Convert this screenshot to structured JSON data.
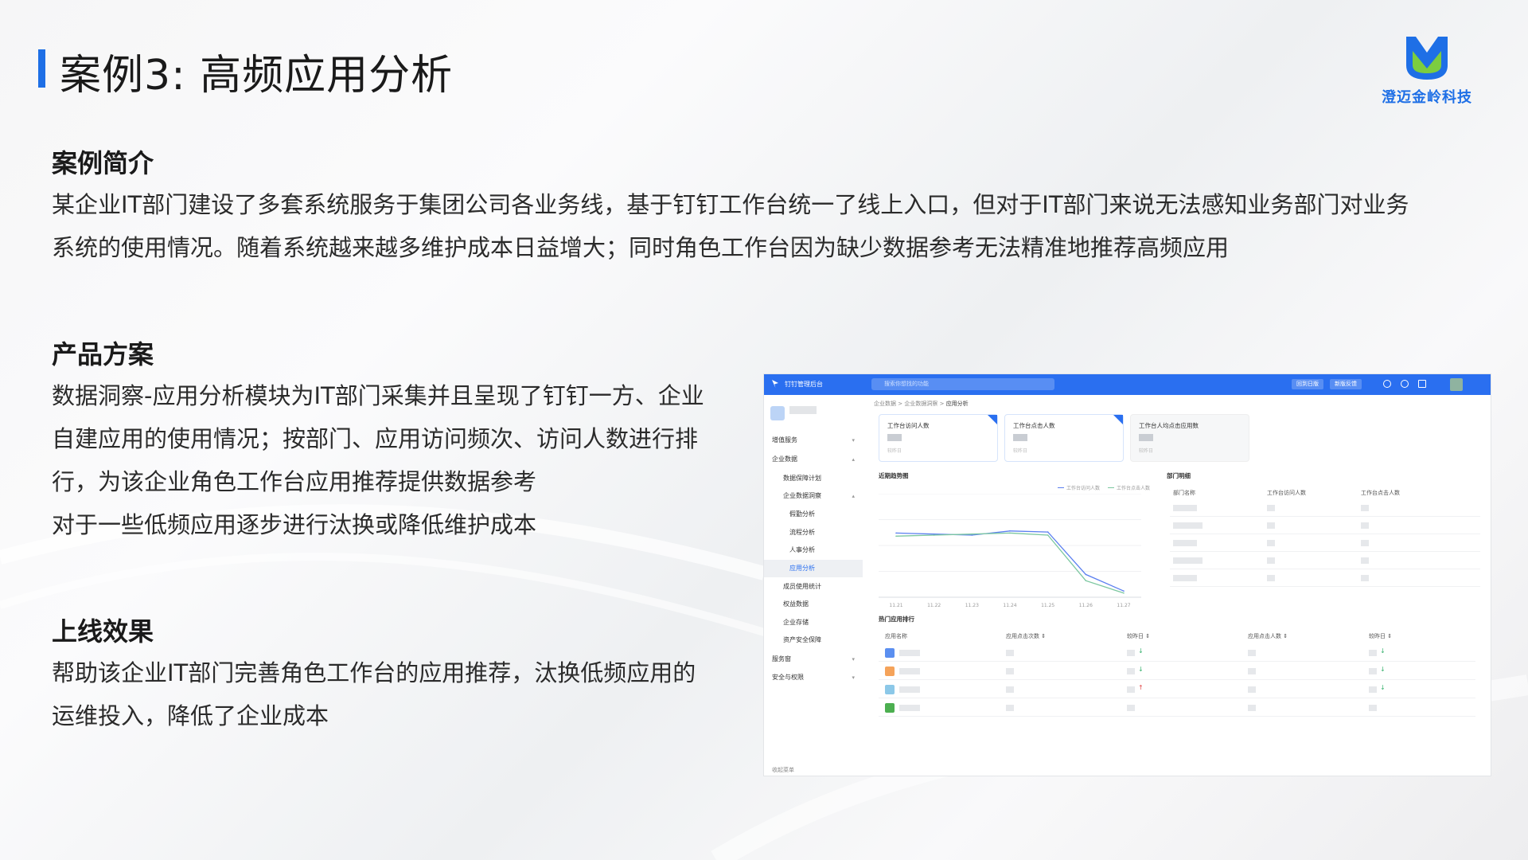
{
  "slide": {
    "title": "案例3: 高频应用分析",
    "logo_text": "澄迈金岭科技",
    "accent_color": "#1e6fe6"
  },
  "sections": {
    "intro": {
      "heading": "案例简介",
      "lines": [
        "某企业IT部门建设了多套系统服务于集团公司各业务线，基于钉钉工作台统一了线上入口，但对于IT部门来说无法感知业务部门对业务",
        "系统的使用情况。随着系统越来越多维护成本日益增大；同时角色工作台因为缺少数据参考无法精准地推荐高频应用"
      ]
    },
    "solution": {
      "heading": "产品方案",
      "lines": [
        "数据洞察-应用分析模块为IT部门采集并且呈现了钉钉一方、企业",
        "自建应用的使用情况；按部门、应用访问频次、访问人数进行排",
        "行，为该企业角色工作台应用推荐提供数据参考",
        "对于一些低频应用逐步进行汰换或降低维护成本"
      ]
    },
    "effect": {
      "heading": "上线效果",
      "lines": [
        "帮助该企业IT部门完善角色工作台的应用推荐，汰换低频应用的",
        "运维投入，降低了企业成本"
      ]
    }
  },
  "app": {
    "brand": "钉钉管理后台",
    "search_placeholder": "搜索你想找的功能",
    "top_buttons": [
      "回到日版",
      "新版反馈"
    ],
    "sidebar": [
      {
        "label": "增值服务",
        "chev": "▾"
      },
      {
        "label": "企业数据",
        "chev": "▴"
      },
      {
        "label": "数据保障计划",
        "chev": ""
      },
      {
        "label": "企业数据洞察",
        "chev": "▴"
      },
      {
        "label": "假勤分析",
        "chev": ""
      },
      {
        "label": "流程分析",
        "chev": ""
      },
      {
        "label": "人事分析",
        "chev": ""
      },
      {
        "label": "应用分析",
        "chev": "",
        "active": true
      },
      {
        "label": "成员使用统计",
        "chev": ""
      },
      {
        "label": "权益数据",
        "chev": ""
      },
      {
        "label": "企业存储",
        "chev": ""
      },
      {
        "label": "资产安全保障",
        "chev": ""
      },
      {
        "label": "服务窗",
        "chev": "▾"
      },
      {
        "label": "安全与权限",
        "chev": "▾"
      }
    ],
    "collapse_label": "收起菜单",
    "breadcrumb": [
      "企业数据",
      "企业数据洞察",
      "应用分析"
    ],
    "breadcrumb_sep": ">",
    "cards": [
      {
        "label": "工作台访问人数",
        "sub": "较昨日"
      },
      {
        "label": "工作台点击人数",
        "sub": "较昨日"
      },
      {
        "label": "工作台人均点击应用数",
        "sub": "较昨日"
      }
    ],
    "trend_title": "近期趋势图",
    "legend": [
      "工作台访问人数",
      "工作台点击人数"
    ],
    "dept_title": "部门明细",
    "dept_headers": [
      "部门名称",
      "工作台访问人数",
      "工作台点击人数"
    ],
    "rank_title": "热门应用排行",
    "rank_headers": [
      "应用名称",
      "应用点击次数 ⇕",
      "较昨日 ⇕",
      "应用点击人数 ⇕",
      "较昨日 ⇕"
    ],
    "rank_icon_colors": [
      "#5b8ff0",
      "#f5a35a",
      "#8cc8e8",
      "#4caf50"
    ],
    "rank_trend": [
      "↓",
      "↓",
      "↑"
    ],
    "rank_trend_right": [
      "↓",
      "↓",
      "↓"
    ]
  },
  "chart_data": {
    "type": "line",
    "title": "近期趋势图",
    "x": [
      "11.21",
      "11.22",
      "11.23",
      "11.24",
      "11.25",
      "11.26",
      "11.27"
    ],
    "series": [
      {
        "name": "工作台访问人数",
        "values": [
          0.62,
          0.61,
          0.6,
          0.64,
          0.63,
          0.22,
          0.06
        ],
        "color": "#5b7ff0"
      },
      {
        "name": "工作台点击人数",
        "values": [
          0.59,
          0.6,
          0.61,
          0.62,
          0.6,
          0.16,
          0.04
        ],
        "color": "#7cc7a0"
      }
    ]
  }
}
